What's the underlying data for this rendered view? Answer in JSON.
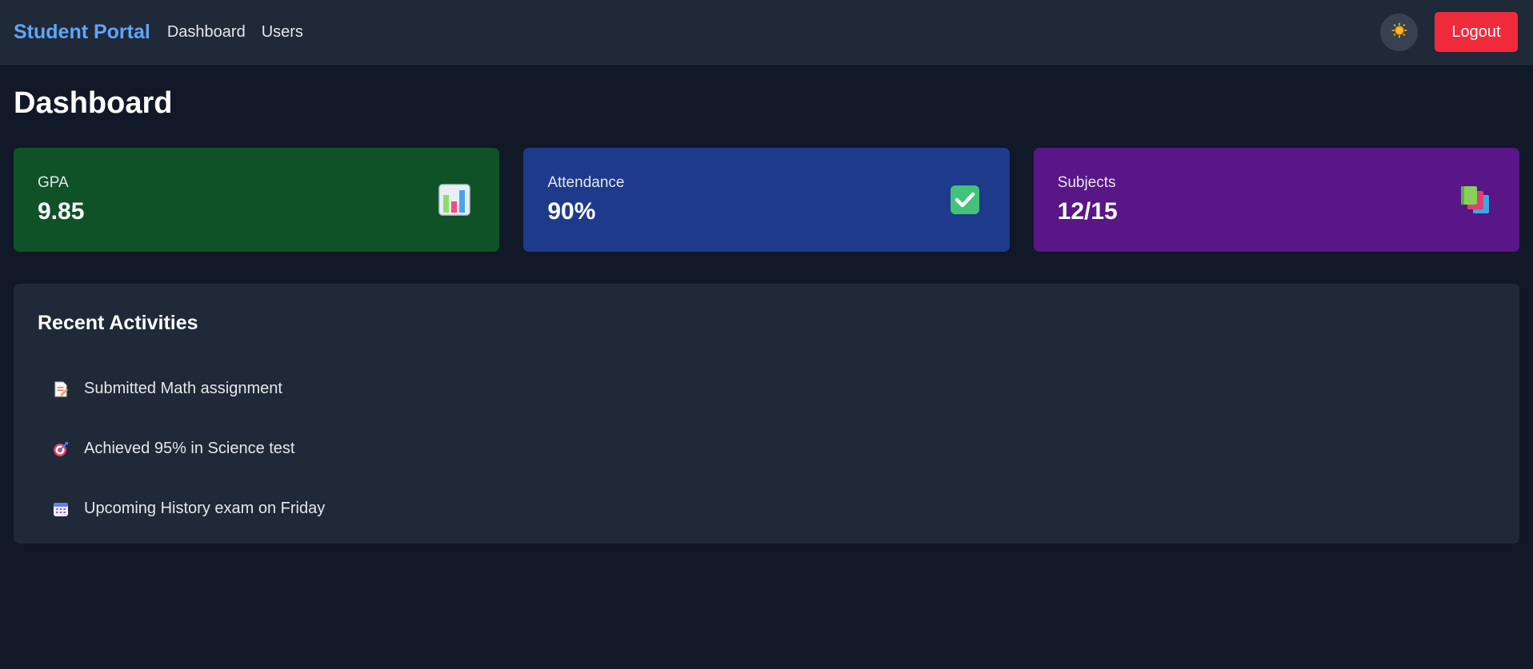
{
  "nav": {
    "brand": "Student Portal",
    "links": [
      "Dashboard",
      "Users"
    ],
    "theme_icon": "sun-icon",
    "logout_label": "Logout",
    "logout_color": "#ef2b3b",
    "brand_color": "#60a5fa"
  },
  "page": {
    "title": "Dashboard"
  },
  "stats": [
    {
      "label": "GPA",
      "value": "9.85",
      "icon": "bar-chart-icon",
      "color": "#0f5227"
    },
    {
      "label": "Attendance",
      "value": "90%",
      "icon": "check-mark-icon",
      "color": "#1e3a8a"
    },
    {
      "label": "Subjects",
      "value": "12/15",
      "icon": "books-icon",
      "color": "#581686"
    }
  ],
  "activities": {
    "title": "Recent Activities",
    "items": [
      {
        "icon": "memo-icon",
        "text": "Submitted Math assignment"
      },
      {
        "icon": "target-icon",
        "text": "Achieved 95% in Science test"
      },
      {
        "icon": "calendar-icon",
        "text": "Upcoming History exam on Friday"
      }
    ]
  }
}
